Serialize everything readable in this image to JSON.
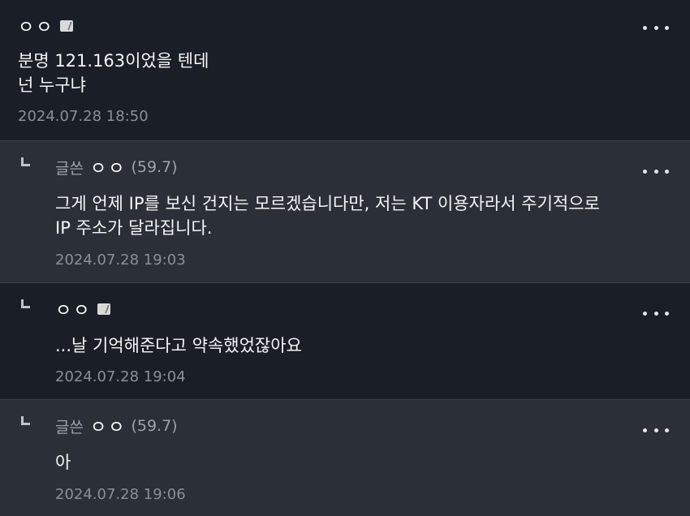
{
  "comments": [
    {
      "nick": "ㅇㅇ",
      "text": "분명 121.163이었을 텐데\n넌 누구냐",
      "date": "2024.07.28 18:50"
    },
    {
      "writer_tag": "글쓴",
      "nick": "ㅇㅇ",
      "ip": "(59.7)",
      "text": "그게 언제 IP를 보신 건지는 모르겠습니다만, 저는 KT 이용자라서 주기적으로\nIP 주소가 달라집니다.",
      "date": "2024.07.28 19:03"
    },
    {
      "nick": "ㅇㅇ",
      "text": "...날 기억해준다고 약속했었잖아요",
      "date": "2024.07.28 19:04"
    },
    {
      "writer_tag": "글쓴",
      "nick": "ㅇㅇ",
      "ip": "(59.7)",
      "text": "아",
      "date": "2024.07.28 19:06"
    }
  ],
  "icons": {
    "more": "more-options-icon",
    "reply": "reply-arrow-icon",
    "fixed_nick": "fixed-nickname-badge-icon"
  },
  "colors": {
    "background_dark": "#1a1e27",
    "background_reply": "#2b2f38",
    "meta_text": "#9ea3ab"
  }
}
